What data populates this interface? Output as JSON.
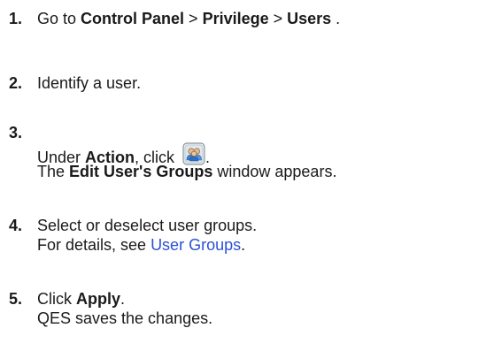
{
  "steps": [
    {
      "number": "1.",
      "parts": {
        "a": "Go to ",
        "b": "Control Panel",
        "c": " > ",
        "d": "Privilege",
        "e": " > ",
        "f": "Users",
        "g": " ."
      }
    },
    {
      "number": "2.",
      "parts": {
        "a": "Identify a user."
      }
    },
    {
      "number": "3.",
      "parts": {
        "a": "Under ",
        "b": "Action",
        "c": ", click ",
        "d": ".",
        "e": "The ",
        "f": "Edit User's Groups",
        "g": " window appears."
      },
      "icon": "user-groups-icon"
    },
    {
      "number": "4.",
      "parts": {
        "a": "Select or deselect user groups.",
        "b": "For details, see ",
        "c": "User Groups",
        "d": "."
      },
      "link_color": "#2b50d8"
    },
    {
      "number": "5.",
      "parts": {
        "a": "Click ",
        "b": "Apply",
        "c": ".",
        "d": "QES saves the changes."
      }
    }
  ]
}
